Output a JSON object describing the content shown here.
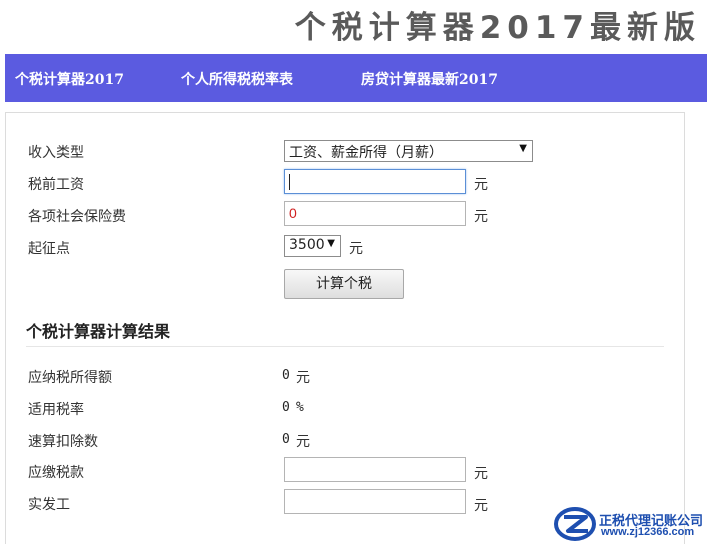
{
  "site": {
    "title": "个税计算器2017最新版"
  },
  "nav": {
    "items": [
      {
        "label": "个税计算器2017"
      },
      {
        "label": "个人所得税税率表"
      },
      {
        "label": "房贷计算器最新2017"
      }
    ]
  },
  "form": {
    "income_type": {
      "label": "收入类型",
      "selected": "工资、薪金所得（月薪）"
    },
    "pretax_salary": {
      "label": "税前工资",
      "value": "",
      "unit": "元"
    },
    "insurance": {
      "label": "各项社会保险费",
      "value": "0",
      "unit": "元"
    },
    "threshold": {
      "label": "起征点",
      "selected": "3500",
      "unit": "元"
    },
    "calculate_label": "计算个税"
  },
  "results": {
    "title": "个税计算器计算结果",
    "taxable_income": {
      "label": "应纳税所得额",
      "value": "0",
      "unit": "元"
    },
    "tax_rate": {
      "label": "适用税率",
      "value": "0",
      "unit": "%"
    },
    "deduction": {
      "label": "速算扣除数",
      "value": "0",
      "unit": "元"
    },
    "tax_payable": {
      "label": "应缴税款",
      "value": "",
      "unit": "元"
    },
    "net_salary": {
      "label": "实发工",
      "value": "",
      "unit": "元"
    }
  },
  "watermark": {
    "name": "正税代理记账公司",
    "url": "www.zj12366.com"
  },
  "colors": {
    "nav_bg": "#5b5be0",
    "title_gray": "#5a5a5a",
    "error_red": "#d02020",
    "logo_blue": "#1e4fb0"
  }
}
